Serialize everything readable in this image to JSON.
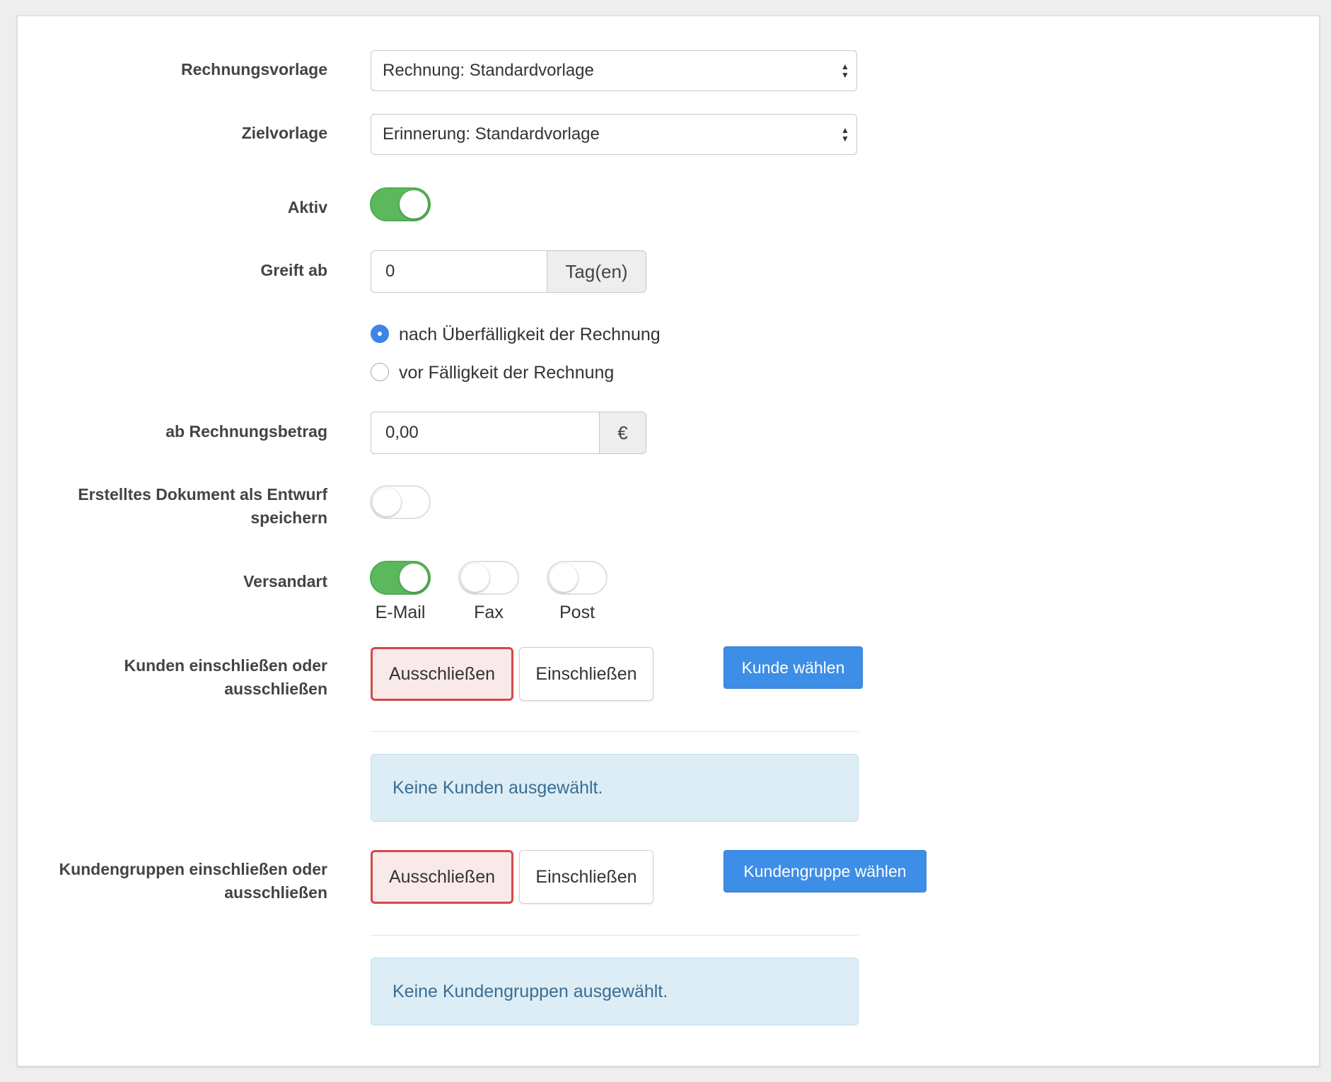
{
  "form": {
    "invoice_template": {
      "label": "Rechnungsvorlage",
      "value": "Rechnung: Standardvorlage"
    },
    "target_template": {
      "label": "Zielvorlage",
      "value": "Erinnerung: Standardvorlage"
    },
    "active": {
      "label": "Aktiv",
      "on": true
    },
    "applies_from": {
      "label": "Greift ab",
      "value": "0",
      "unit": "Tag(en)"
    },
    "timing_options": [
      {
        "label": "nach Überfälligkeit der Rechnung",
        "checked": true
      },
      {
        "label": "vor Fälligkeit der Rechnung",
        "checked": false
      }
    ],
    "min_amount": {
      "label": "ab Rechnungsbetrag",
      "value": "0,00",
      "unit": "€"
    },
    "save_as_draft": {
      "label": "Erstelltes Dokument als Entwurf speichern",
      "on": false
    },
    "shipping": {
      "label": "Versandart",
      "options": [
        {
          "label": "E-Mail",
          "on": true
        },
        {
          "label": "Fax",
          "on": false
        },
        {
          "label": "Post",
          "on": false
        }
      ]
    },
    "customers": {
      "label": "Kunden einschließen oder ausschließen",
      "exclude": "Ausschließen",
      "include": "Einschließen",
      "selected": "exclude",
      "choose_button": "Kunde wählen",
      "empty_message": "Keine Kunden ausgewählt."
    },
    "customer_groups": {
      "label": "Kundengruppen einschließen oder ausschließen",
      "exclude": "Ausschließen",
      "include": "Einschließen",
      "selected": "exclude",
      "choose_button": "Kundengruppe wählen",
      "empty_message": "Keine Kundengruppen ausgewählt."
    }
  },
  "colors": {
    "toggle_on": "#5cb85c",
    "primary": "#3d8ee6",
    "danger": "#d14a4a",
    "info_bg": "#dcedf6"
  }
}
